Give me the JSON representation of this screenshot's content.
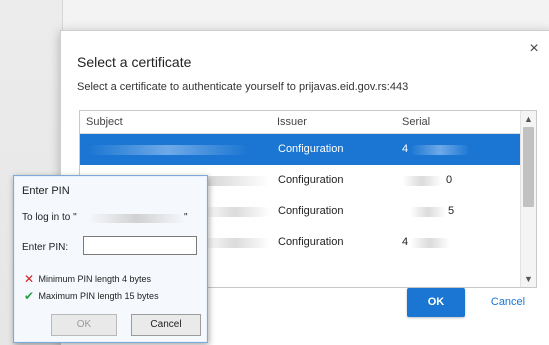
{
  "certificate_dialog": {
    "title": "Select a certificate",
    "subtitle": "Select a certificate to authenticate yourself to prijavas.eid.gov.rs:443",
    "close_icon": "×",
    "columns": {
      "subject": "Subject",
      "issuer": "Issuer",
      "serial": "Serial"
    },
    "rows": [
      {
        "issuer": "Configuration",
        "serial": "4",
        "selected": true
      },
      {
        "issuer": "Configuration",
        "serial": "0",
        "selected": false
      },
      {
        "issuer": "Configuration",
        "serial": "5",
        "selected": false
      },
      {
        "issuer": "Configuration",
        "serial": "4",
        "selected": false
      }
    ],
    "ok_label": "OK",
    "cancel_label": "Cancel",
    "accent_color": "#1a76d2"
  },
  "pin_dialog": {
    "title": "Enter PIN",
    "login_label": "To log in to \"",
    "login_close": "\"",
    "pin_label": "Enter PIN:",
    "requirements": [
      {
        "icon": "cross-icon",
        "glyph": "✕",
        "text": "Minimum PIN length 4 bytes"
      },
      {
        "icon": "check-icon",
        "glyph": "✔",
        "text": "Maximum PIN length 15 bytes"
      }
    ],
    "ok_label": "OK",
    "cancel_label": "Cancel"
  }
}
